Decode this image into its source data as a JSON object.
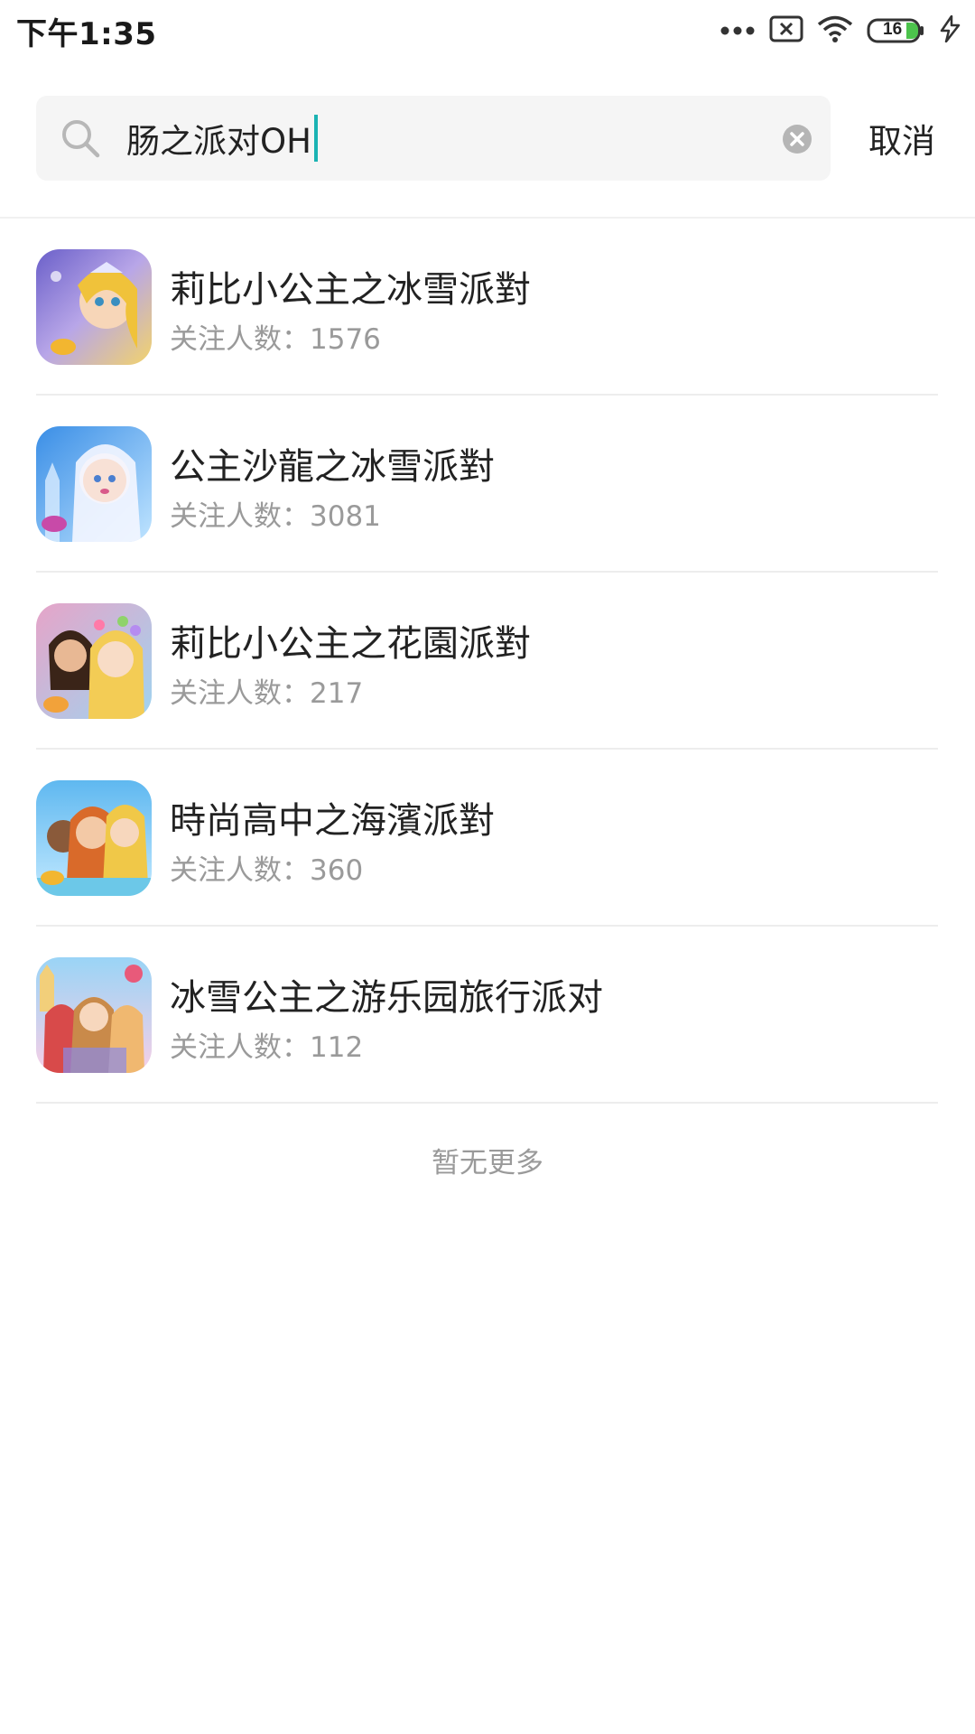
{
  "status_bar": {
    "time": "下午1:35",
    "battery": "16",
    "icons": [
      "more-dots-icon",
      "sim-error-icon",
      "wifi-icon",
      "battery-icon",
      "charging-icon"
    ]
  },
  "search": {
    "query": "肠之派对OH",
    "cancel_label": "取消",
    "icons": [
      "search-icon",
      "clear-icon"
    ]
  },
  "results": [
    {
      "title": "莉比小公主之冰雪派對",
      "followers_label": "关注人数：",
      "followers": "1576"
    },
    {
      "title": "公主沙龍之冰雪派對",
      "followers_label": "关注人数：",
      "followers": "3081"
    },
    {
      "title": "莉比小公主之花園派對",
      "followers_label": "关注人数：",
      "followers": "217"
    },
    {
      "title": "時尚高中之海濱派對",
      "followers_label": "关注人数：",
      "followers": "360"
    },
    {
      "title": "冰雪公主之游乐园旅行派对",
      "followers_label": "关注人数：",
      "followers": "112"
    }
  ],
  "footer": {
    "no_more": "暂无更多"
  },
  "colors": {
    "accent_caret": "#1bb3b3",
    "text_primary": "#222222",
    "text_secondary": "#9a9a9a"
  }
}
